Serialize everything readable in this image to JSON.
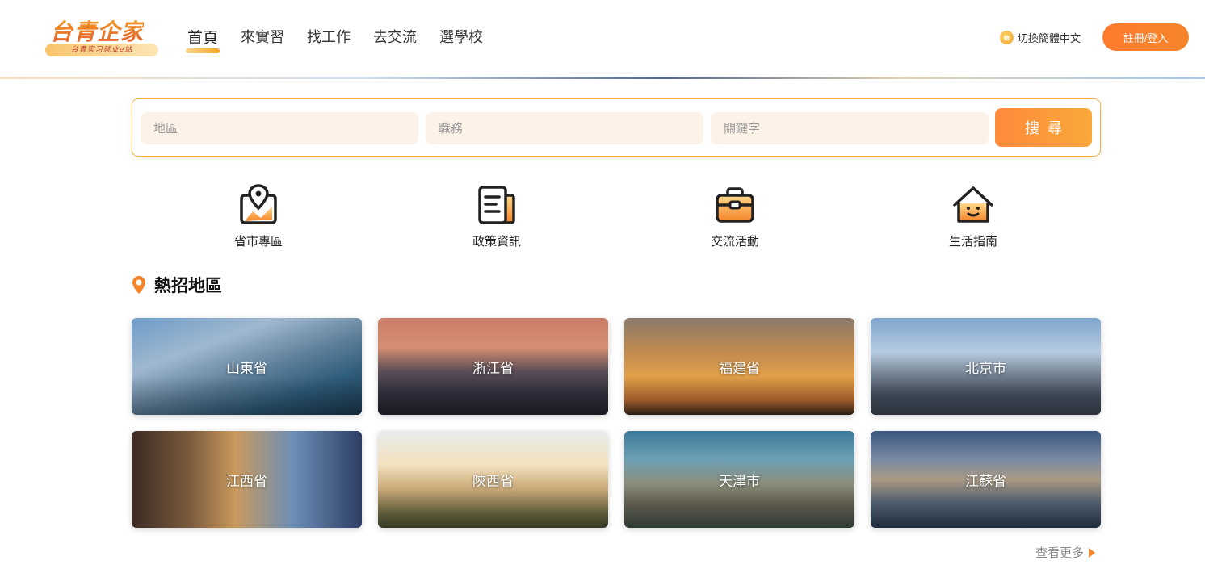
{
  "header": {
    "logo_title": "台青企家",
    "logo_sub": "台青实习就业e站",
    "nav": [
      {
        "label": "首頁",
        "active": true
      },
      {
        "label": "來實習",
        "active": false
      },
      {
        "label": "找工作",
        "active": false
      },
      {
        "label": "去交流",
        "active": false
      },
      {
        "label": "選學校",
        "active": false
      }
    ],
    "lang_icon": "e",
    "lang_label": "切換簡體中文",
    "login_label": "註冊/登入"
  },
  "search": {
    "region_placeholder": "地區",
    "job_placeholder": "職務",
    "keyword_placeholder": "關鍵字",
    "button_label": "搜尋"
  },
  "quick_links": [
    {
      "label": "省市專區",
      "icon": "map-pin-icon"
    },
    {
      "label": "政策資訊",
      "icon": "document-icon"
    },
    {
      "label": "交流活動",
      "icon": "briefcase-icon"
    },
    {
      "label": "生活指南",
      "icon": "home-icon"
    }
  ],
  "hot_regions": {
    "title": "熱招地區",
    "items": [
      {
        "label": "山東省"
      },
      {
        "label": "浙江省"
      },
      {
        "label": "福建省"
      },
      {
        "label": "北京市"
      },
      {
        "label": "江西省"
      },
      {
        "label": "陝西省"
      },
      {
        "label": "天津市"
      },
      {
        "label": "江蘇省"
      }
    ],
    "more_label": "查看更多"
  },
  "colors": {
    "accent": "#f5852a",
    "accent_light": "#fdf2e8",
    "border": "#f3b24d"
  }
}
